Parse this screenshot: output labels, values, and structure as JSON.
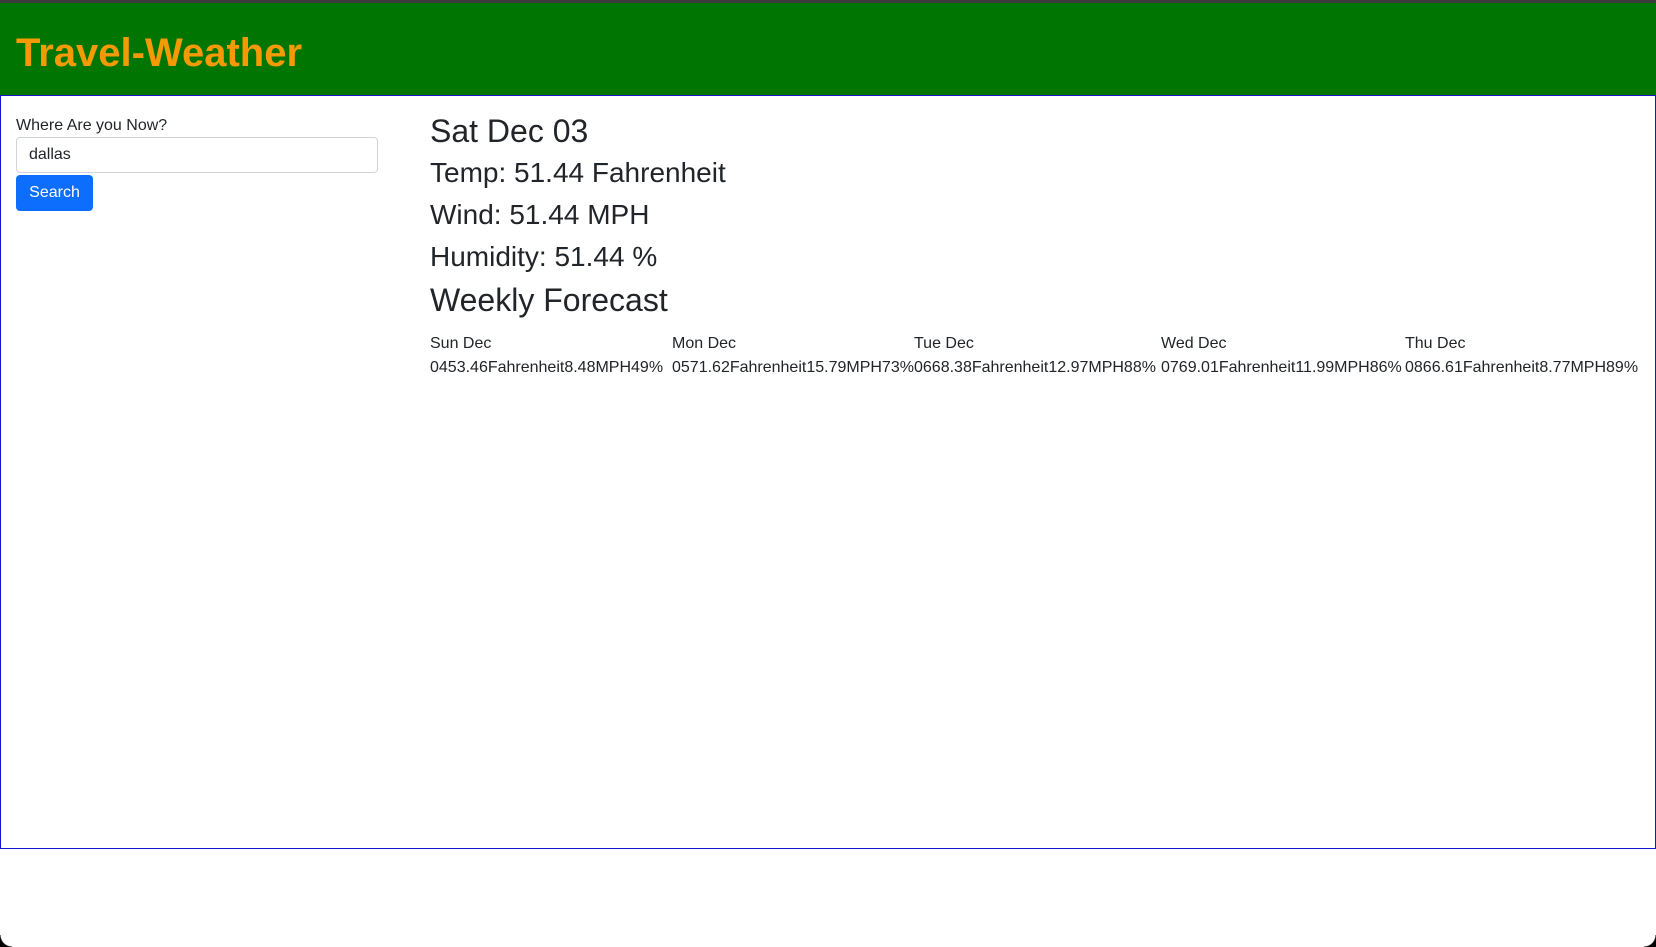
{
  "header": {
    "title": "Travel-Weather",
    "background": "#017501",
    "title_color": "#f59a05"
  },
  "search": {
    "label": "Where Are you Now?",
    "value": "dallas",
    "button_label": "Search",
    "button_color": "#0d6efd"
  },
  "current": {
    "date": "Sat Dec 03",
    "temp": "Temp: 51.44 Fahrenheit",
    "wind": "Wind: 51.44 MPH",
    "humidity": "Humidity: 51.44 %"
  },
  "forecast": {
    "heading": "Weekly Forecast",
    "days": [
      {
        "name": "Sun Dec",
        "values": "0453.46Fahrenheit8.48MPH49%"
      },
      {
        "name": "Mon Dec",
        "values": "0571.62Fahrenheit15.79MPH73%"
      },
      {
        "name": "Tue Dec",
        "values": "0668.38Fahrenheit12.97MPH88%"
      },
      {
        "name": "Wed Dec",
        "values": "0769.01Fahrenheit11.99MPH86%"
      },
      {
        "name": "Thu Dec",
        "values": "0866.61Fahrenheit8.77MPH89%"
      }
    ]
  }
}
